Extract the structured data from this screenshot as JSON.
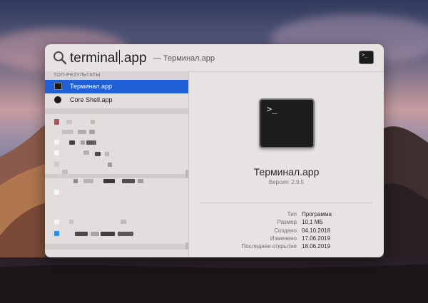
{
  "search": {
    "typed": "terminal",
    "completion": ".app",
    "hint": "— Терминал.app"
  },
  "results": {
    "section_header": "ТОП-РЕЗУЛЬТАТЫ",
    "items": [
      {
        "label": "Терминал.app",
        "icon": "terminal-icon",
        "selected": true
      },
      {
        "label": "Core Shell.app",
        "icon": "core-shell-icon",
        "selected": false
      }
    ]
  },
  "preview": {
    "icon_text": ">_",
    "app_name": "Терминал.app",
    "version": "Версия: 2.9.5",
    "metadata": [
      {
        "key": "Тип",
        "value": "Программа"
      },
      {
        "key": "Размер",
        "value": "10,1 МБ"
      },
      {
        "key": "Создано",
        "value": "04.10.2018"
      },
      {
        "key": "Изменено",
        "value": "17.06.2019"
      },
      {
        "key": "Последнее открытие",
        "value": "18.06.2019"
      }
    ]
  },
  "colors": {
    "selection": "#1f5fd7",
    "panel": "#e7e3e2"
  }
}
